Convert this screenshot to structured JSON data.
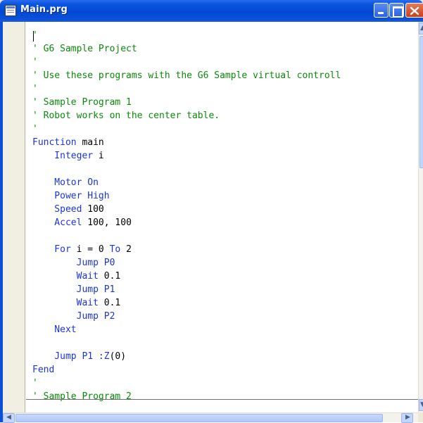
{
  "window": {
    "title": "Main.prg",
    "icon": "program-file-icon"
  },
  "title_buttons": {
    "minimize": "minimize-icon",
    "maximize": "maximize-icon",
    "close": "close-icon"
  },
  "editor": {
    "lines": [
      {
        "text": "'",
        "kind": "comment"
      },
      {
        "text": "' G6 Sample Project",
        "kind": "comment"
      },
      {
        "text": "'",
        "kind": "comment"
      },
      {
        "text": "' Use these programs with the G6 Sample virtual controll",
        "kind": "comment"
      },
      {
        "text": "'",
        "kind": "comment"
      },
      {
        "text": "' Sample Program 1",
        "kind": "comment"
      },
      {
        "text": "' Robot works on the center table.",
        "kind": "comment"
      },
      {
        "text": "'",
        "kind": "comment"
      },
      {
        "text": "Function main",
        "kind": "mixed",
        "parts": [
          [
            "Function",
            "blue"
          ],
          [
            " main",
            "black"
          ]
        ]
      },
      {
        "text": "    Integer i",
        "kind": "mixed",
        "parts": [
          [
            "    Integer",
            "blue"
          ],
          [
            " i",
            "black"
          ]
        ]
      },
      {
        "text": "",
        "kind": "blank"
      },
      {
        "text": "    Motor On",
        "kind": "blue"
      },
      {
        "text": "    Power High",
        "kind": "blue"
      },
      {
        "text": "    Speed 100",
        "kind": "mixed",
        "parts": [
          [
            "    Speed",
            "blue"
          ],
          [
            " 100",
            "black"
          ]
        ]
      },
      {
        "text": "    Accel 100, 100",
        "kind": "mixed",
        "parts": [
          [
            "    Accel",
            "blue"
          ],
          [
            " 100, 100",
            "black"
          ]
        ]
      },
      {
        "text": "",
        "kind": "blank"
      },
      {
        "text": "    For i = 0 To 2",
        "kind": "mixed",
        "parts": [
          [
            "    For",
            "blue"
          ],
          [
            " i = 0 ",
            "black"
          ],
          [
            "To",
            "blue"
          ],
          [
            " 2",
            "black"
          ]
        ]
      },
      {
        "text": "        Jump P0",
        "kind": "blue"
      },
      {
        "text": "        Wait 0.1",
        "kind": "mixed",
        "parts": [
          [
            "        Wait",
            "blue"
          ],
          [
            " 0.1",
            "black"
          ]
        ]
      },
      {
        "text": "        Jump P1",
        "kind": "blue"
      },
      {
        "text": "        Wait 0.1",
        "kind": "mixed",
        "parts": [
          [
            "        Wait",
            "blue"
          ],
          [
            " 0.1",
            "black"
          ]
        ]
      },
      {
        "text": "        Jump P2",
        "kind": "blue"
      },
      {
        "text": "    Next",
        "kind": "blue"
      },
      {
        "text": "",
        "kind": "blank"
      },
      {
        "text": "    Jump P1 :Z(0)",
        "kind": "mixed",
        "parts": [
          [
            "    Jump P1 :Z",
            "blue"
          ],
          [
            "(0)",
            "black"
          ]
        ]
      },
      {
        "text": "Fend",
        "kind": "blue"
      },
      {
        "text": "'",
        "kind": "comment"
      },
      {
        "text": "' Sample Program 2",
        "kind": "comment"
      }
    ]
  },
  "scrollbars": {
    "up_icon": "scroll-up-arrow-icon",
    "down_icon": "scroll-down-arrow-icon",
    "left_icon": "scroll-left-arrow-icon",
    "right_icon": "scroll-right-arrow-icon"
  }
}
